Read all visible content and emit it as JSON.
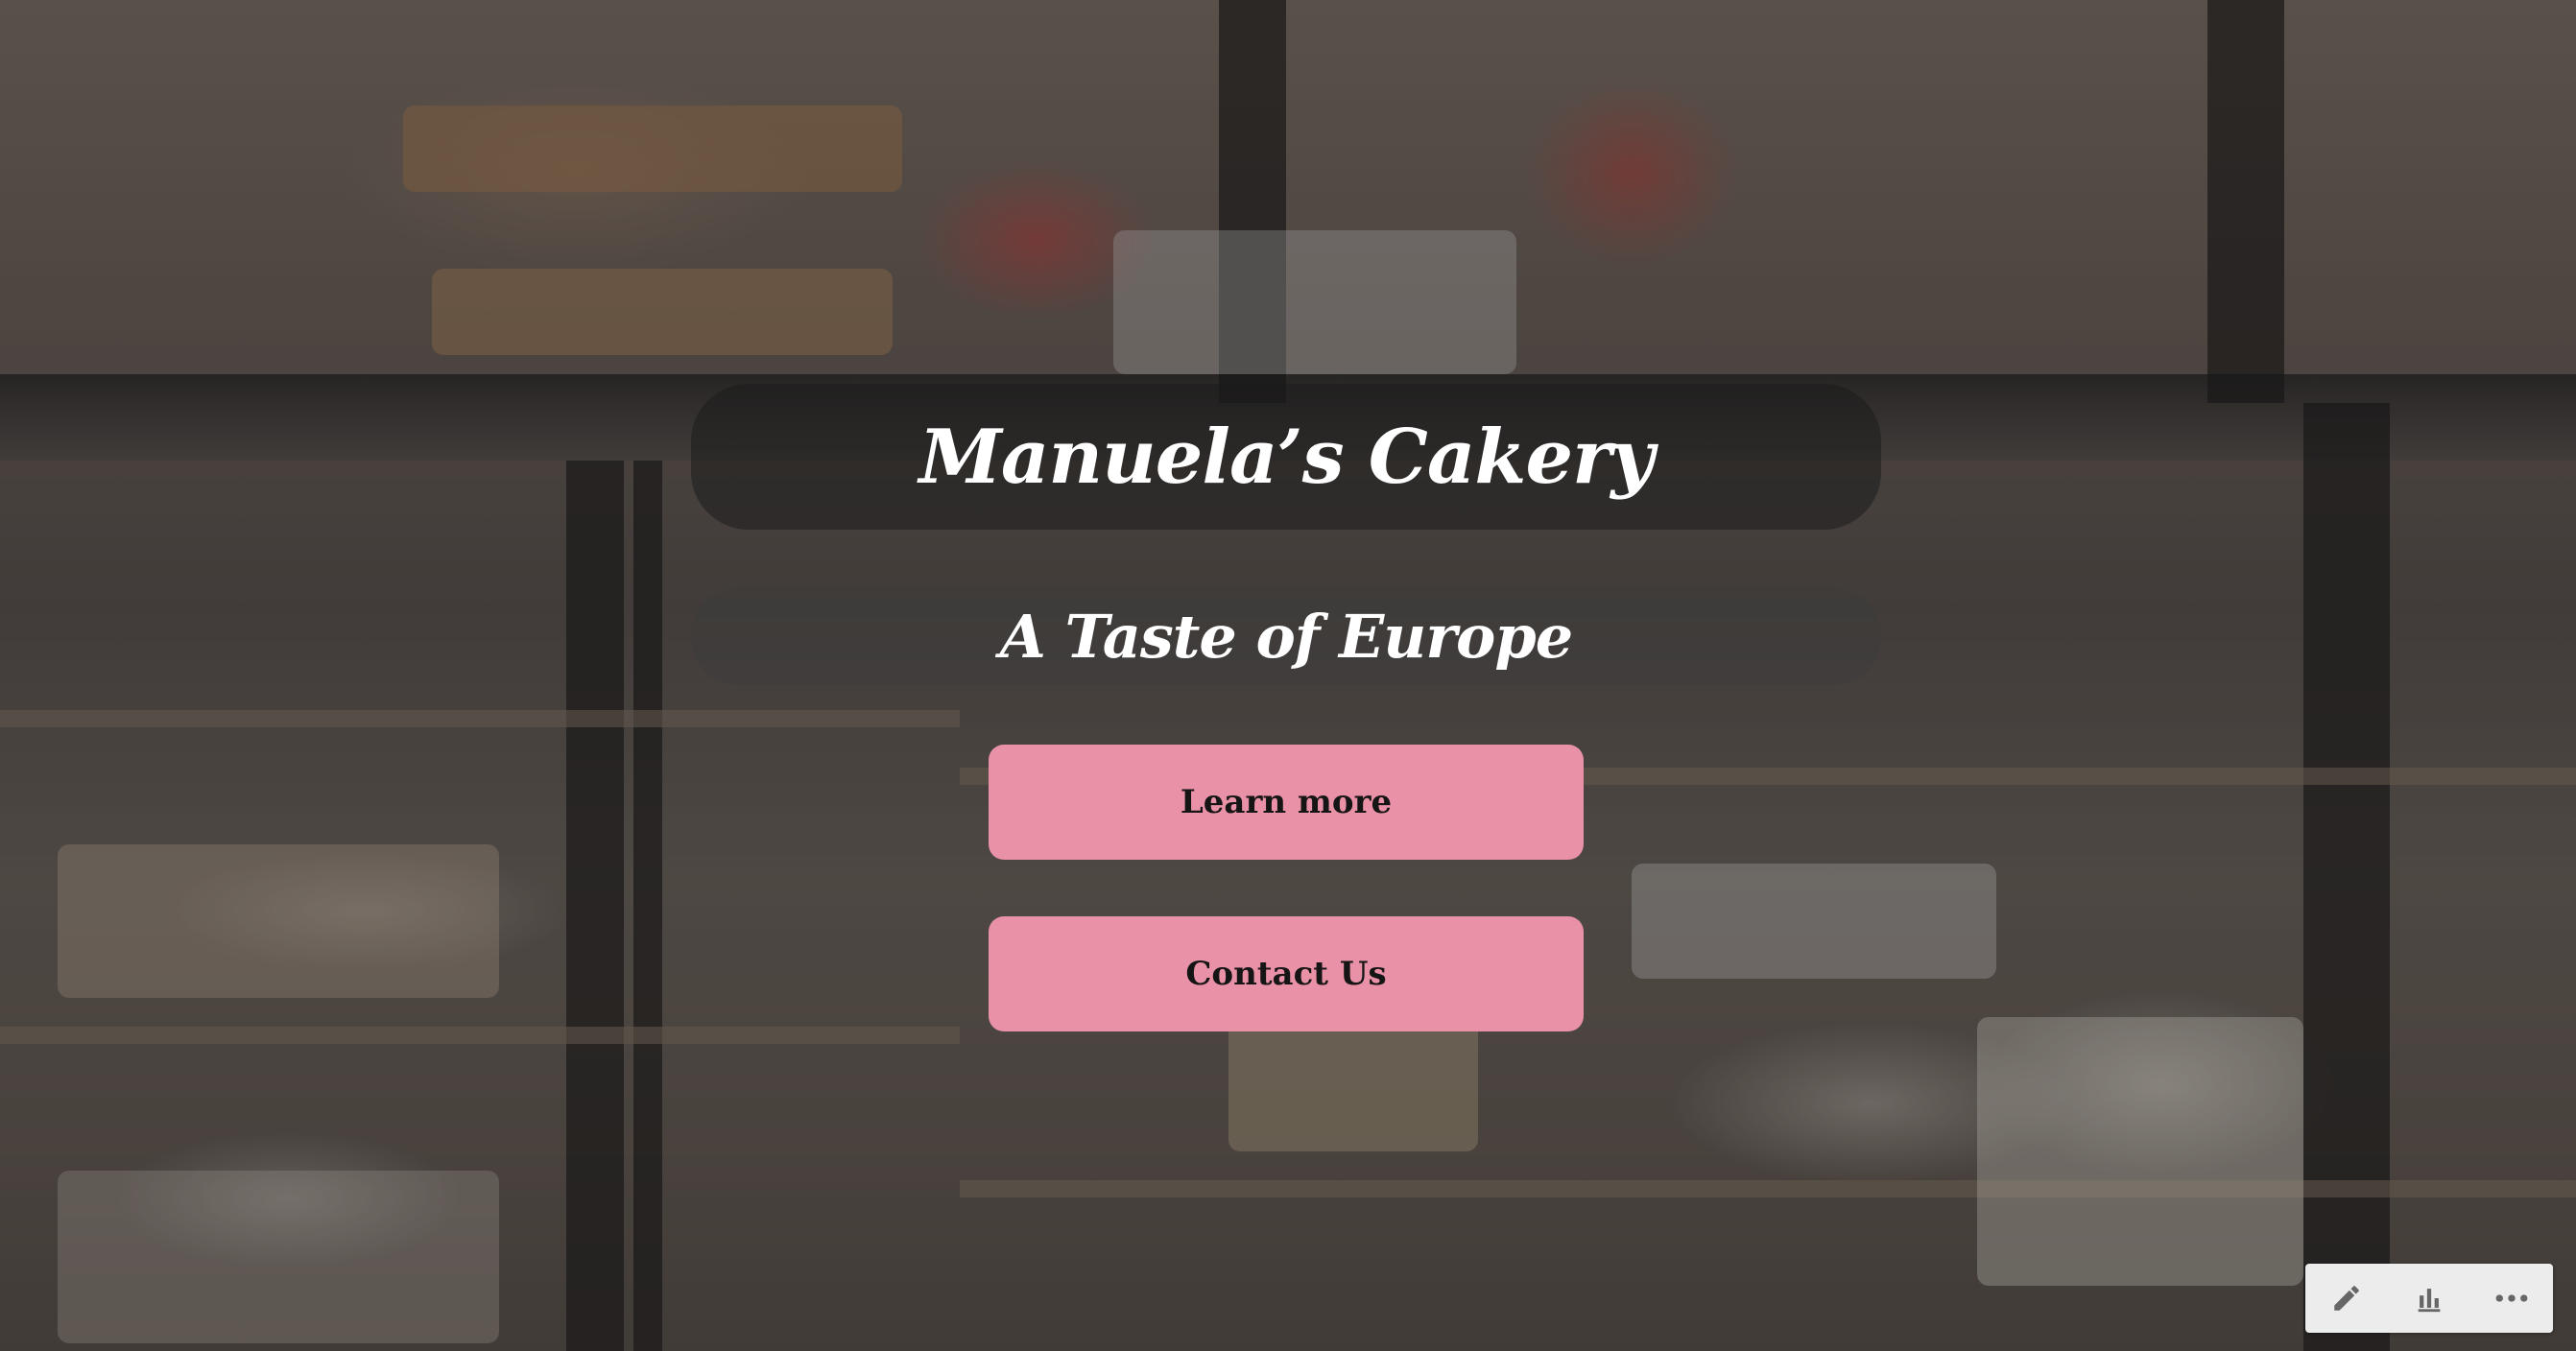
{
  "hero": {
    "title": "Manuela’s Cakery",
    "subtitle": "A Taste of Europe"
  },
  "buttons": {
    "learn_more": "Learn more",
    "contact_us": "Contact Us"
  },
  "toolbar": {
    "icons": [
      "pencil-icon",
      "bar-chart-icon",
      "more-icon"
    ]
  },
  "colors": {
    "button_bg": "#e991a6",
    "button_text": "#151515",
    "title_text": "#ffffff",
    "toolbar_bg": "#ececec",
    "toolbar_icon": "#666666"
  }
}
